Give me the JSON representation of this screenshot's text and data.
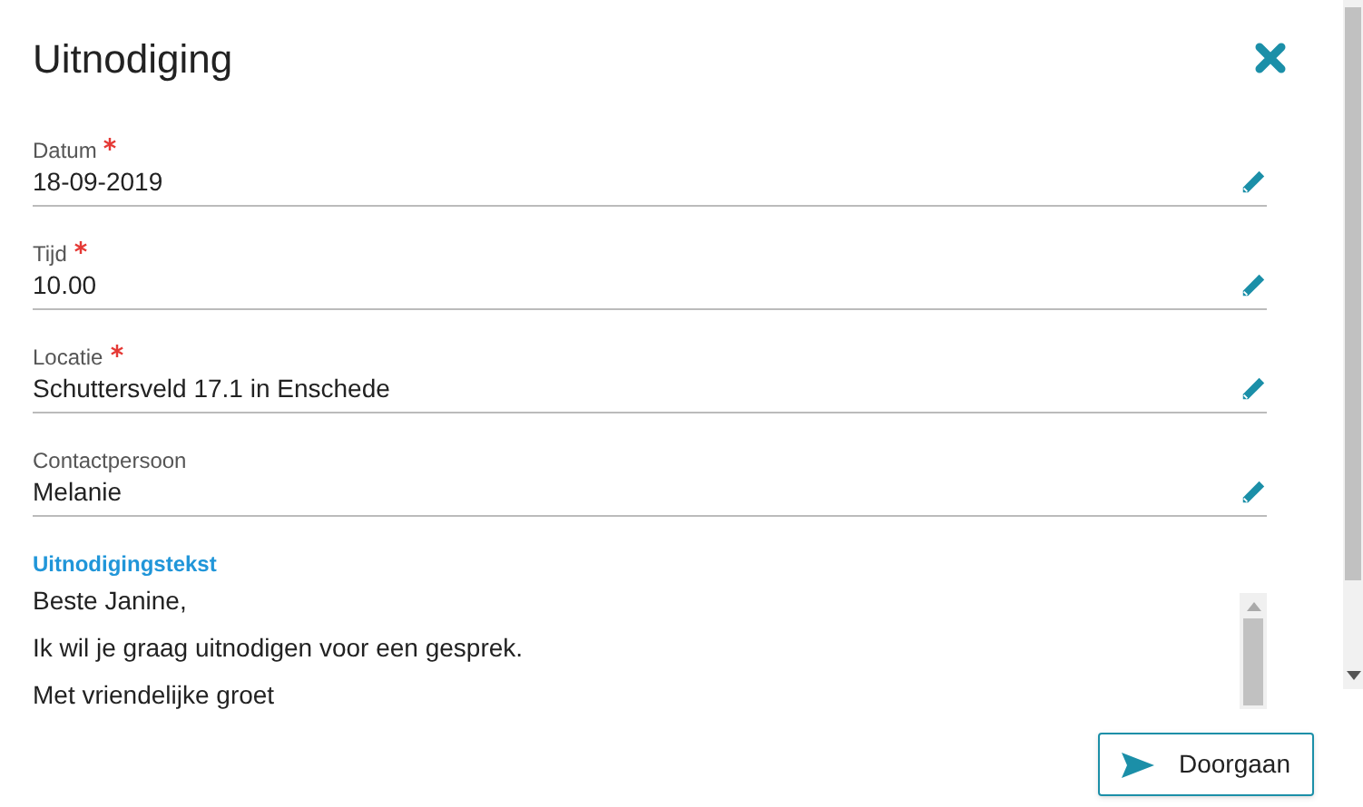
{
  "dialog": {
    "title": "Uitnodiging"
  },
  "fields": [
    {
      "label": "Datum",
      "required": true,
      "value": "18-09-2019"
    },
    {
      "label": "Tijd",
      "required": true,
      "value": "10.00"
    },
    {
      "label": "Locatie",
      "required": true,
      "value": "Schuttersveld 17.1 in Enschede"
    },
    {
      "label": "Contactpersoon",
      "required": false,
      "value": "Melanie"
    }
  ],
  "message": {
    "label": "Uitnodigingstekst",
    "lines": [
      "Beste Janine,",
      "Ik wil je graag uitnodigen voor een gesprek.",
      "Met vriendelijke groet"
    ]
  },
  "buttons": [
    {
      "label": "Doorgaan"
    }
  ]
}
